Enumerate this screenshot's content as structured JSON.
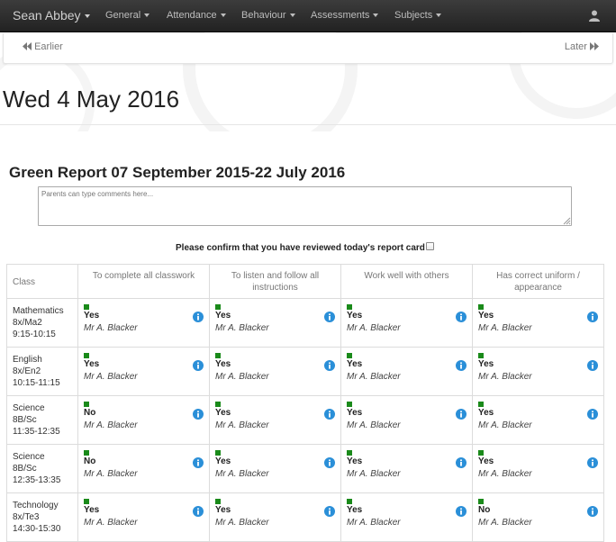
{
  "navbar": {
    "brand": "Sean Abbey",
    "menus": [
      "General",
      "Attendance",
      "Behaviour",
      "Assessments",
      "Subjects"
    ]
  },
  "pager": {
    "earlier": "Earlier",
    "later": "Later"
  },
  "page_title": "Wed 4 May 2016",
  "report_title": "Green Report 07 September 2015-22 July 2016",
  "comments_placeholder": "Parents can type comments here...",
  "confirm_label": "Please confirm that you have reviewed today's report card",
  "table": {
    "headers": [
      "Class",
      "To complete all classwork",
      "To listen and follow all instructions",
      "Work well with others",
      "Has correct uniform / appearance"
    ],
    "rows": [
      {
        "subject": "Mathematics",
        "group": "8x/Ma2",
        "time": "9:15-10:15",
        "cells": [
          {
            "value": "Yes",
            "teacher": "Mr A. Blacker"
          },
          {
            "value": "Yes",
            "teacher": "Mr A. Blacker"
          },
          {
            "value": "Yes",
            "teacher": "Mr A. Blacker"
          },
          {
            "value": "Yes",
            "teacher": "Mr A. Blacker"
          }
        ]
      },
      {
        "subject": "English",
        "group": "8x/En2",
        "time": "10:15-11:15",
        "cells": [
          {
            "value": "Yes",
            "teacher": "Mr A. Blacker"
          },
          {
            "value": "Yes",
            "teacher": "Mr A. Blacker"
          },
          {
            "value": "Yes",
            "teacher": "Mr A. Blacker"
          },
          {
            "value": "Yes",
            "teacher": "Mr A. Blacker"
          }
        ]
      },
      {
        "subject": "Science",
        "group": "8B/Sc",
        "time": "11:35-12:35",
        "cells": [
          {
            "value": "No",
            "teacher": "Mr A. Blacker"
          },
          {
            "value": "Yes",
            "teacher": "Mr A. Blacker"
          },
          {
            "value": "Yes",
            "teacher": "Mr A. Blacker"
          },
          {
            "value": "Yes",
            "teacher": "Mr A. Blacker"
          }
        ]
      },
      {
        "subject": "Science",
        "group": "8B/Sc",
        "time": "12:35-13:35",
        "cells": [
          {
            "value": "No",
            "teacher": "Mr A. Blacker"
          },
          {
            "value": "Yes",
            "teacher": "Mr A. Blacker"
          },
          {
            "value": "Yes",
            "teacher": "Mr A. Blacker"
          },
          {
            "value": "Yes",
            "teacher": "Mr A. Blacker"
          }
        ]
      },
      {
        "subject": "Technology",
        "group": "8x/Te3",
        "time": "14:30-15:30",
        "cells": [
          {
            "value": "Yes",
            "teacher": "Mr A. Blacker"
          },
          {
            "value": "Yes",
            "teacher": "Mr A. Blacker"
          },
          {
            "value": "Yes",
            "teacher": "Mr A. Blacker"
          },
          {
            "value": "No",
            "teacher": "Mr A. Blacker"
          }
        ]
      }
    ]
  },
  "colors": {
    "navbar": "#222222",
    "status_square": "#1a8a1a",
    "info_icon": "#2a8fd8"
  },
  "icons": {
    "user": "user-icon",
    "earlier": "double-chevron-left-icon",
    "later": "double-chevron-right-icon",
    "info": "info-icon",
    "status": "status-square-icon"
  }
}
